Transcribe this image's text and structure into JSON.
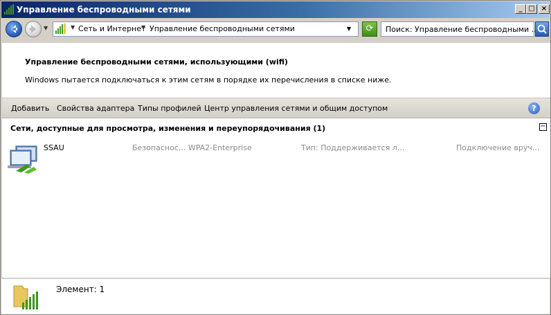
{
  "window": {
    "title": "Управление беспроводными сетями",
    "title_icon": "wireless-signal-icon"
  },
  "nav": {
    "breadcrumb": [
      "Сеть и Интернет",
      "Управление беспроводными сетями"
    ],
    "search_placeholder": "Поиск: Управление беспроводными ..."
  },
  "header": {
    "title": "Управление беспроводными сетями, использующими (wifi)",
    "subtitle": "Windows пытается подключаться к этим сетям в порядке их перечисления в списке ниже."
  },
  "toolbar": {
    "items": [
      "Добавить",
      "Свойства адаптера",
      "Типы профилей",
      "Центр управления сетями и общим доступом"
    ],
    "help": "?"
  },
  "group": {
    "heading": "Сети, доступные для просмотра, изменения и переупорядочивания (1)",
    "collapse_glyph": "−"
  },
  "networks": [
    {
      "name": "SSAU",
      "security": "Безопаснос...  WPA2-Enterprise",
      "type": "Тип:  Поддерживается л...",
      "connect": "Подключение вруч..."
    }
  ],
  "status": {
    "text": "Элемент: 1"
  },
  "colors": {
    "titlebar_start": "#0a246a",
    "titlebar_end": "#a6caf0",
    "signal_green": "#3a9a1a"
  }
}
